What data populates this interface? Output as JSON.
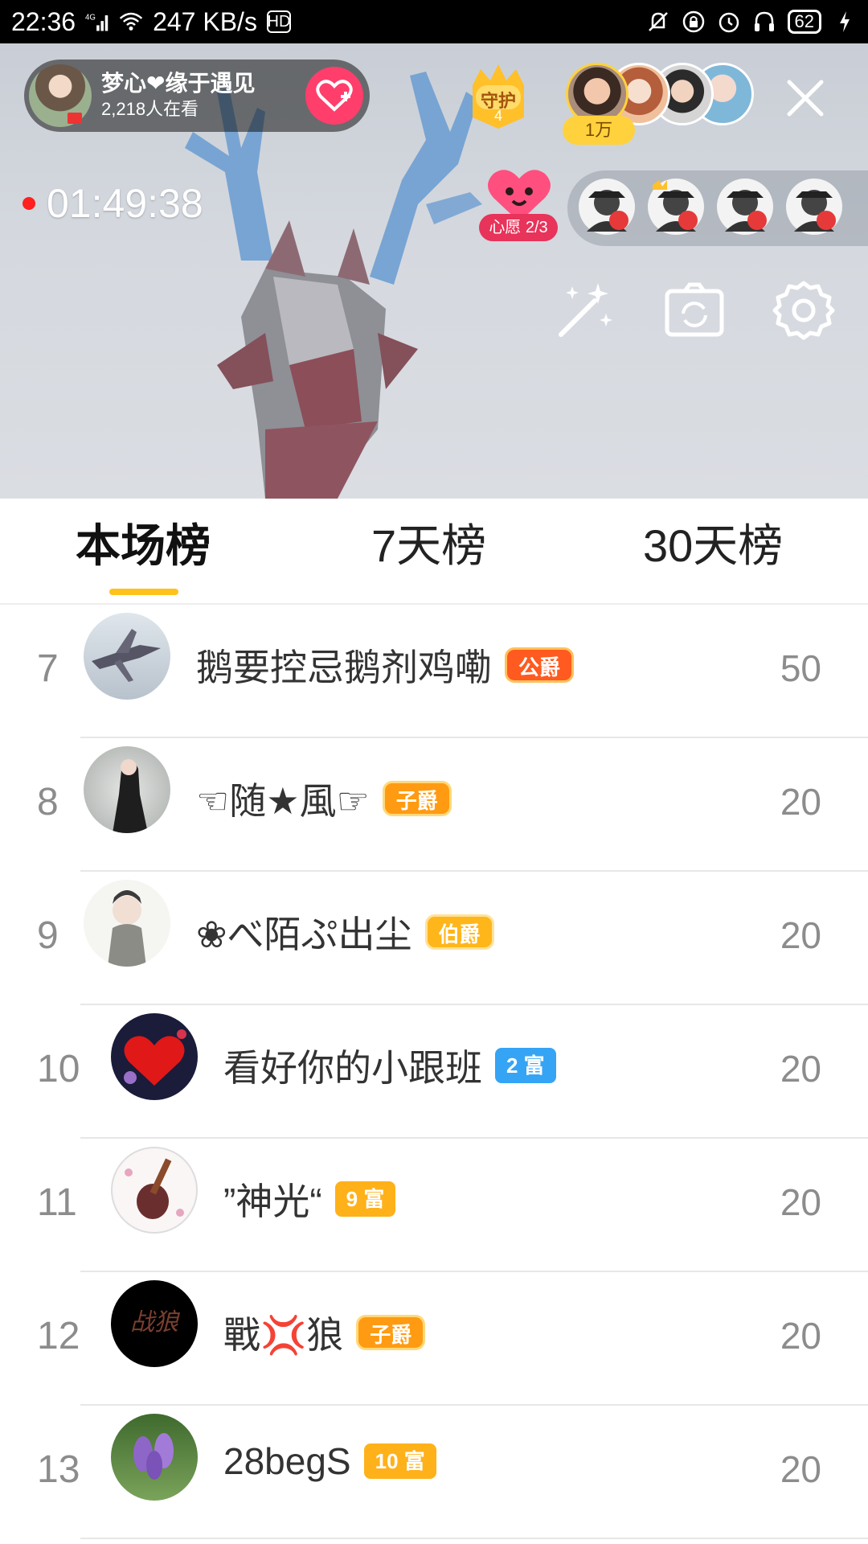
{
  "status_bar": {
    "time": "22:36",
    "network": "4G",
    "speed": "247 KB/s",
    "hd": "HD",
    "battery": "62",
    "icons": [
      "signal-icon",
      "wifi-icon",
      "hd-icon",
      "mute-icon",
      "lock-icon",
      "alarm-icon",
      "headphones-icon",
      "battery-icon",
      "charging-icon"
    ]
  },
  "live": {
    "anchor_name": "梦心❤缘于遇见",
    "viewers": "2,218人在看",
    "guard_label": "守护",
    "guard_count": "4",
    "contrib_tag": "1万",
    "timer": "01:49:38",
    "wish_label": "心愿 2/3"
  },
  "tabs": [
    {
      "label": "本场榜",
      "active": true
    },
    {
      "label": "7天榜",
      "active": false
    },
    {
      "label": "30天榜",
      "active": false
    }
  ],
  "ranking": [
    {
      "rank": "7",
      "name": "鹅要控忌鹅剂鸡嘞",
      "badge": "公爵",
      "badge_type": "duke",
      "score": "50"
    },
    {
      "rank": "8",
      "name": "☜随★風☞",
      "badge": "子爵",
      "badge_type": "viscount",
      "score": "20"
    },
    {
      "rank": "9",
      "name": "❀べ陌ぷ出尘",
      "badge": "伯爵",
      "badge_type": "earl",
      "score": "20"
    },
    {
      "rank": "10",
      "name": "看好你的小跟班",
      "badge": "2 富",
      "badge_type": "rich-blue",
      "score": "20"
    },
    {
      "rank": "11",
      "name": "”神光“",
      "badge": "9 富",
      "badge_type": "rich-orange",
      "score": "20"
    },
    {
      "rank": "12",
      "name": "戰💢狼",
      "badge": "子爵",
      "badge_type": "viscount",
      "score": "20"
    },
    {
      "rank": "13",
      "name": "28begS",
      "badge": "10 富",
      "badge_type": "rich-orange",
      "score": "20"
    }
  ]
}
